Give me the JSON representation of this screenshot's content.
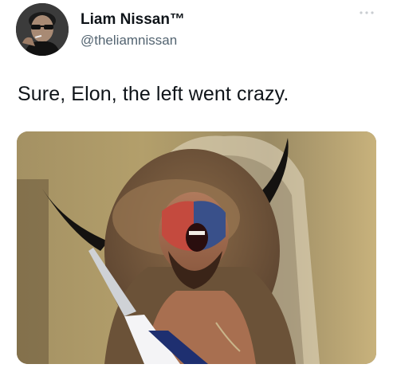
{
  "tweet": {
    "author_name": "Liam Nissan™",
    "author_handle": "@theliamnissan",
    "text": "Sure, Elon, the left went crazy.",
    "more_icon": "ellipsis-icon",
    "avatar_icon": "avatar-photo",
    "media_icon": "tweet-photo"
  }
}
